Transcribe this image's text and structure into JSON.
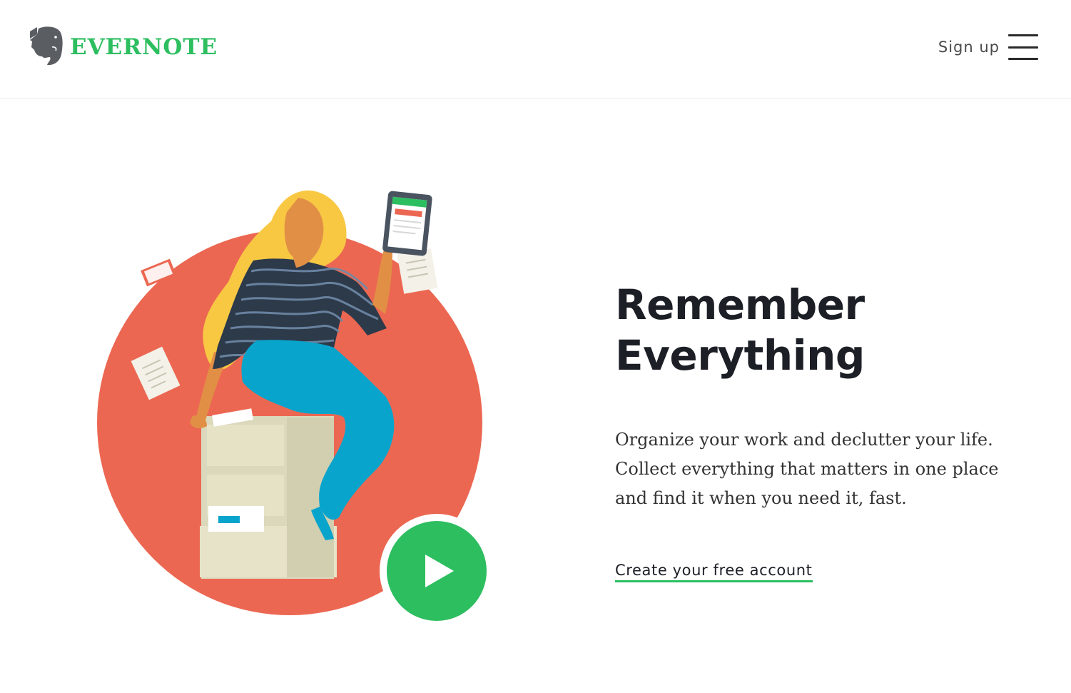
{
  "header": {
    "brand": "EVERNOTE",
    "signup_label": "Sign up",
    "logo_icon": "evernote-elephant-icon",
    "menu_icon": "hamburger-menu-icon"
  },
  "hero": {
    "headline_line1": "Remember",
    "headline_line2": "Everything",
    "description_lines": [
      "Organize your work and declutter your life.",
      "Collect everything that matters in one place",
      "and find it when you need it, fast."
    ],
    "cta_label": "Create your free account",
    "play_icon": "play-icon"
  },
  "colors": {
    "brand_green": "#2dbe60",
    "circle_coral": "#ec6752",
    "hair_yellow": "#f9c843",
    "pants_blue": "#08a4cc",
    "text_dark": "#1d1f26"
  }
}
